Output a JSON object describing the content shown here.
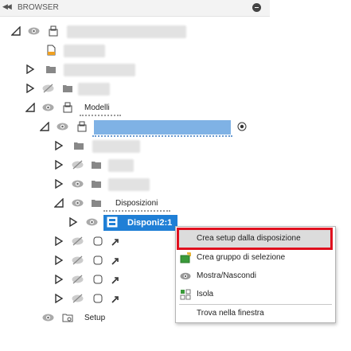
{
  "header": {
    "title": "BROWSER"
  },
  "tree": {
    "modelli_label": "Modelli",
    "disposizioni_label": "Disposizioni",
    "selected_label": "Disponi2:1",
    "setup_label": "Setup"
  },
  "context_menu": {
    "items": [
      {
        "label": "Crea setup dalla disposizione",
        "icon": "none",
        "highlighted": true
      },
      {
        "label": "Crea gruppo di selezione",
        "icon": "selection-group-icon"
      },
      {
        "label": "Mostra/Nascondi",
        "icon": "eye-icon"
      },
      {
        "label": "Isola",
        "icon": "isolate-icon"
      },
      {
        "label": "Trova nella finestra",
        "icon": "none"
      }
    ]
  },
  "colors": {
    "selection_blue": "#1f7fd6",
    "highlight_red": "#e0101e",
    "accent_blue": "#7fb2e5"
  }
}
